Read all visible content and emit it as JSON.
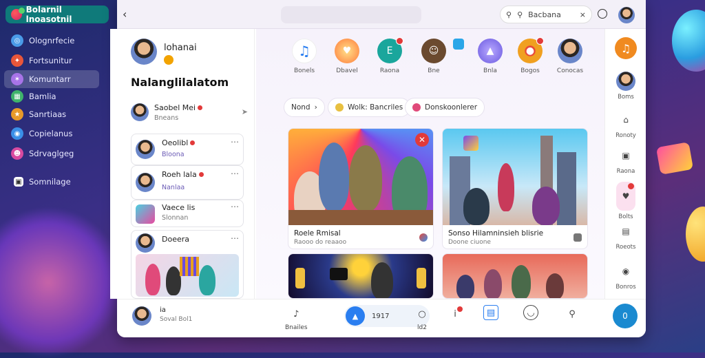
{
  "sidebar": {
    "brand": "Bolarnil lnoasotnil",
    "items": [
      {
        "label": "Olognrfecie",
        "icon": "globe-icon",
        "color": "#4a9be8"
      },
      {
        "label": "Fortsunitur",
        "icon": "flame-icon",
        "color": "#e8563a"
      },
      {
        "label": "Komuntarr",
        "icon": "people-icon",
        "color": "#a874e8"
      },
      {
        "label": "Bamlia",
        "icon": "grid-icon",
        "color": "#3fb36b"
      },
      {
        "label": "Sanrtiaas",
        "icon": "star-icon",
        "color": "#e89a2a"
      },
      {
        "label": "Copielanus",
        "icon": "chat-icon",
        "color": "#3a8fe8"
      },
      {
        "label": "Sdrvaglgeg",
        "icon": "person-icon",
        "color": "#d84aa0"
      },
      {
        "label": "Somnilage",
        "icon": "image-icon",
        "color": "#ffffff"
      }
    ]
  },
  "topbar": {
    "search_text": "Bacbana"
  },
  "profile": {
    "name": "lohanai",
    "heading": "Nalanglilalatom"
  },
  "chat_summary": {
    "title": "Saobel Mei",
    "sub": "Bneans"
  },
  "chats": [
    {
      "name": "Oeolibl",
      "sub": "Bloona"
    },
    {
      "name": "Roeh lala",
      "sub": "Nanlaa"
    },
    {
      "name": "Vaece lis",
      "sub": "Slonnan"
    },
    {
      "name": "Doeera",
      "sub": ""
    }
  ],
  "apps": [
    {
      "label": "Bonels",
      "color": "#2a7ef0",
      "glyph": "♫"
    },
    {
      "label": "Dbavel",
      "color": "#ff7a3a",
      "glyph": "♥"
    },
    {
      "label": "Raona",
      "color": "#1aa69c",
      "glyph": "E"
    },
    {
      "label": "Bne",
      "color": "#6b4a2f",
      "glyph": "☺"
    },
    {
      "label": "Bnla",
      "color": "#6b5ae0",
      "glyph": "▲"
    },
    {
      "label": "Bogos",
      "color": "#f0a020",
      "glyph": "●"
    },
    {
      "label": "Conocas",
      "color": "#c94a3a",
      "glyph": ""
    }
  ],
  "chips": [
    {
      "label": "Nond"
    },
    {
      "label": "Wolk: Bancriles"
    },
    {
      "label": "Donskoonlerer"
    }
  ],
  "posts": [
    {
      "title": "Roele Rmisal",
      "sub": "Raooo do reaaoo"
    },
    {
      "title": "Sonso Hilamninsieh blisrie",
      "sub": "Doone ciuone"
    }
  ],
  "rightbar": [
    {
      "label": "",
      "glyph": "♫"
    },
    {
      "label": "Boms",
      "glyph": ""
    },
    {
      "label": "Ronoty",
      "glyph": "⌂"
    },
    {
      "label": "Raona",
      "glyph": "▣"
    },
    {
      "label": "Bolts",
      "glyph": "♥"
    },
    {
      "label": "Roeots",
      "glyph": "▤"
    },
    {
      "label": "Bonros",
      "glyph": "◉"
    }
  ],
  "bottom": {
    "user_name": "ia",
    "user_sub": "Soval Bol1",
    "items": [
      {
        "label": "Bnailes",
        "glyph": "♪"
      },
      {
        "label": "1917",
        "glyph": "▲"
      },
      {
        "label": "ld2",
        "glyph": "○"
      },
      {
        "label": "",
        "glyph": "i"
      },
      {
        "label": "",
        "glyph": "▤"
      },
      {
        "label": "",
        "glyph": "◌"
      },
      {
        "label": "",
        "glyph": "⚲"
      }
    ],
    "fab": "0"
  }
}
